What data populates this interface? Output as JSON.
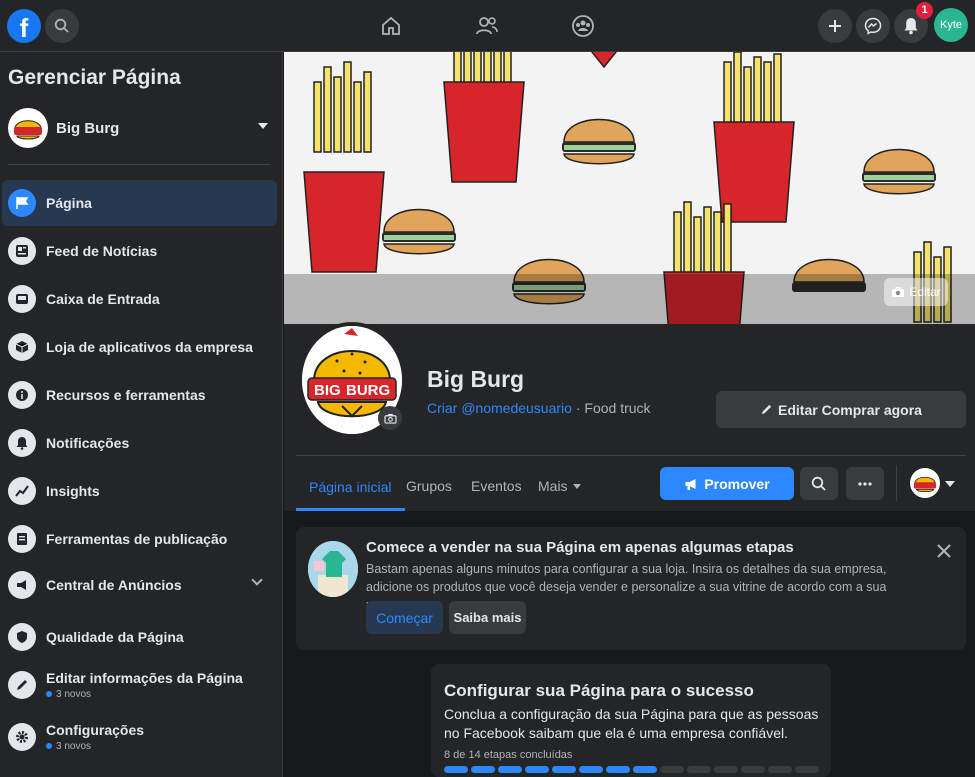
{
  "topbar": {
    "logo_letter": "f",
    "user_initials": "Kyte",
    "notification_count": "1"
  },
  "sidebar": {
    "title": "Gerenciar Página",
    "page_name": "Big Burg",
    "items": [
      {
        "label": "Página",
        "icon": "flag-icon"
      },
      {
        "label": "Feed de Notícias",
        "icon": "news-feed-icon"
      },
      {
        "label": "Caixa de Entrada",
        "icon": "inbox-icon"
      },
      {
        "label": "Loja de aplicativos da empresa",
        "icon": "app-store-icon"
      },
      {
        "label": "Recursos e ferramentas",
        "icon": "info-icon"
      },
      {
        "label": "Notificações",
        "icon": "bell-icon"
      },
      {
        "label": "Insights",
        "icon": "insights-icon"
      },
      {
        "label": "Ferramentas de publicação",
        "icon": "publishing-icon"
      },
      {
        "label": "Central de Anúncios",
        "icon": "megaphone-icon"
      },
      {
        "label": "Qualidade da Página",
        "icon": "shield-icon"
      },
      {
        "label": "Editar informações da Página",
        "icon": "pencil-icon",
        "sub": "3 novos"
      },
      {
        "label": "Configurações",
        "icon": "gear-icon",
        "sub": "3 novos"
      }
    ]
  },
  "cover": {
    "edit_label": "Editar"
  },
  "profile": {
    "name": "Big Burg",
    "username_link": "Criar @nomedeusuario",
    "category": " · Food truck",
    "edit_buy_label": "Editar Comprar agora",
    "logo_text_big": "BIG",
    "logo_text_burg": "BURG"
  },
  "tabs": {
    "items": [
      "Página inicial",
      "Grupos",
      "Eventos",
      "Mais"
    ],
    "promote_label": "Promover"
  },
  "sell_card": {
    "title": "Comece a vender na sua Página em apenas algumas etapas",
    "description": "Bastam apenas alguns minutos para configurar a sua loja. Insira os detalhes da sua empresa, adicione os produtos que você deseja vender e personalize a sua vitrine de acordo com a sua marca.",
    "start_label": "Começar",
    "more_label": "Saiba mais"
  },
  "setup_card": {
    "title": "Configurar sua Página para o sucesso",
    "description": "Conclua a configuração da sua Página para que as pessoas no Facebook saibam que ela é uma empresa confiável.",
    "steps_text": "8 de 14 etapas concluídas",
    "steps_done": 8,
    "steps_total": 14
  },
  "colors": {
    "accent": "#2d88ff",
    "background": "#18191a",
    "surface": "#242526",
    "fries_red": "#d7262b",
    "burger_bun": "#e0a45a"
  }
}
